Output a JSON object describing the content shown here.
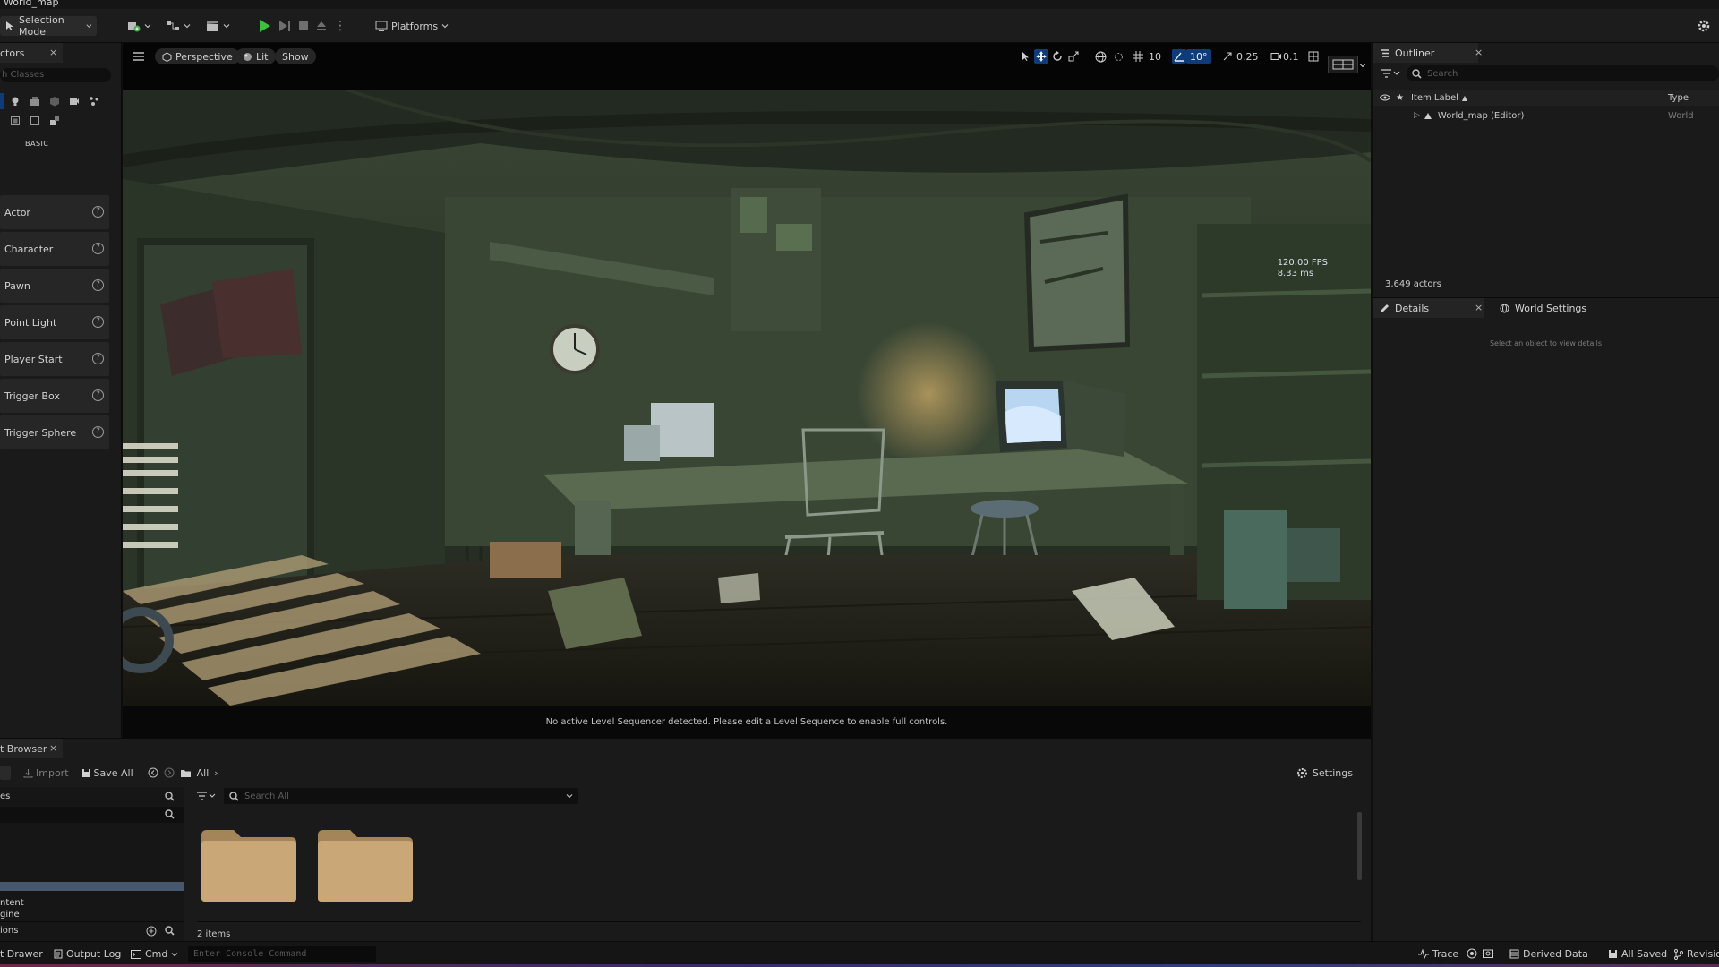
{
  "app": {
    "level_name": "World_map"
  },
  "main_toolbar": {
    "selection_mode": "Selection Mode",
    "platforms": "Platforms"
  },
  "place_actors": {
    "tab_label": "ctors",
    "class_search_placeholder": "h Classes",
    "category_label": "BASIC",
    "items": [
      {
        "label": "Actor"
      },
      {
        "label": "Character"
      },
      {
        "label": "Pawn"
      },
      {
        "label": "Point Light"
      },
      {
        "label": "Player Start"
      },
      {
        "label": "Trigger Box"
      },
      {
        "label": "Trigger Sphere"
      }
    ]
  },
  "viewport": {
    "view_mode": "Perspective",
    "lighting_mode": "Lit",
    "show_label": "Show",
    "grid_snap_value": "10",
    "rotation_snap_value": "10°",
    "scale_snap_value": "0.25",
    "camera_speed_value": "0.1",
    "fps": "120.00 FPS",
    "frame_time": "8.33 ms",
    "sequencer_message": "No active Level Sequencer detected. Please edit a Level Sequence to enable full controls."
  },
  "outliner": {
    "tab_label": "Outliner",
    "search_placeholder": "Search",
    "col_item_label": "Item Label",
    "col_type": "Type",
    "rows": [
      {
        "label": "World_map (Editor)",
        "type": "World"
      }
    ],
    "actor_count": "3,649 actors"
  },
  "details": {
    "tab_label": "Details",
    "world_settings_label": "World Settings",
    "empty_message": "Select an object to view details"
  },
  "content_browser": {
    "tab_label": "t Browser",
    "import_label": "Import",
    "save_all_label": "Save All",
    "path_all": "All",
    "settings_label": "Settings",
    "sources_header": "es",
    "search_placeholder": "Search All",
    "sources": [
      {
        "label": "ntent"
      },
      {
        "label": "gine"
      }
    ],
    "collections_header": "ions",
    "item_count": "2 items"
  },
  "status_bar": {
    "content_drawer": "t Drawer",
    "output_log": "Output Log",
    "cmd": "Cmd",
    "console_placeholder": "Enter Console Command",
    "trace": "Trace",
    "derived_data": "Derived Data",
    "all_saved": "All Saved",
    "revision": "Revisio"
  },
  "colors": {
    "accent_blue": "#0f3c78",
    "play_green": "#3fbf3f",
    "folder_tan": "#c9a776",
    "panel_bg": "#1a1a1a"
  }
}
